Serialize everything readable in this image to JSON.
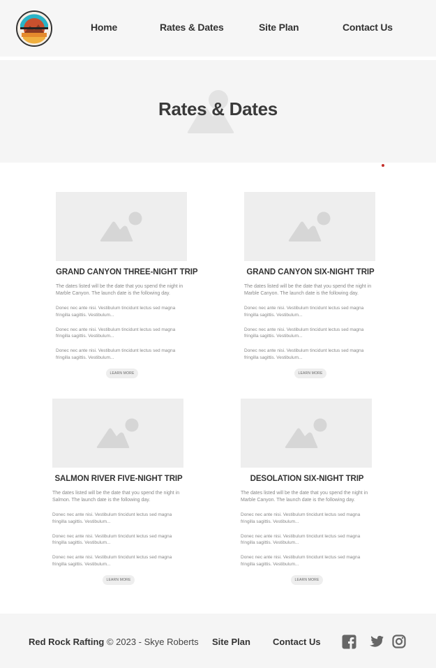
{
  "nav": {
    "logo": "red-rock-rafting-logo",
    "items": [
      "Home",
      "Rates & Dates",
      "Site Plan",
      "Contact Us"
    ]
  },
  "hero": {
    "title": "Rates & Dates"
  },
  "cards": [
    {
      "title": "GRAND CANYON THREE-NIGHT TRIP",
      "intro": "The dates listed will be the date that you spend the night in Marble Canyon. The launch date is the following day.",
      "paras": [
        "Donec nec ante nisi. Vestibulum tincidunt lectus sed magna fringilla sagittis. Vestibulum...",
        "Donec nec ante nisi. Vestibulum tincidunt lectus sed magna fringilla sagittis. Vestibulum...",
        "Donec nec ante nisi. Vestibulum tincidunt lectus sed magna fringilla sagittis. Vestibulum..."
      ],
      "button": "LEARN MORE"
    },
    {
      "title": "GRAND CANYON SIX-NIGHT TRIP",
      "intro": "The dates listed will be the date that you spend the night in Marble Canyon. The launch date is the following day.",
      "paras": [
        "Donec nec ante nisi. Vestibulum tincidunt lectus sed magna fringilla sagittis. Vestibulum...",
        "Donec nec ante nisi. Vestibulum tincidunt lectus sed magna fringilla sagittis. Vestibulum...",
        "Donec nec ante nisi. Vestibulum tincidunt lectus sed magna fringilla sagittis. Vestibulum..."
      ],
      "button": "LEARN MORE"
    },
    {
      "title": "SALMON RIVER FIVE-NIGHT TRIP",
      "intro": "The dates listed will be the date that you spend the night in Salmon. The launch date is the following day.",
      "paras": [
        "Donec nec ante nisi. Vestibulum tincidunt lectus sed magna fringilla sagittis. Vestibulum...",
        "Donec nec ante nisi. Vestibulum tincidunt lectus sed magna fringilla sagittis. Vestibulum...",
        "Donec nec ante nisi. Vestibulum tincidunt lectus sed magna fringilla sagittis. Vestibulum..."
      ],
      "button": "LEARN MORE"
    },
    {
      "title": "DESOLATION SIX-NIGHT TRIP",
      "intro": "The dates listed will be the date that you spend the night in Marble Canyon. The launch date is the following day.",
      "paras": [
        "Donec nec ante nisi. Vestibulum tincidunt lectus sed magna fringilla sagittis. Vestibulum...",
        "Donec nec ante nisi. Vestibulum tincidunt lectus sed magna fringilla sagittis. Vestibulum...",
        "Donec nec ante nisi. Vestibulum tincidunt lectus sed magna fringilla sagittis. Vestibulum..."
      ],
      "button": "LEARN MORE"
    }
  ],
  "footer": {
    "brand": "Red Rock Rafting",
    "copyright": " © 2023 - Skye Roberts",
    "links": [
      "Site Plan",
      "Contact Us"
    ],
    "social": [
      "facebook-icon",
      "twitter-icon",
      "instagram-icon"
    ]
  },
  "colors": {
    "header_bg": "#f6f6f6",
    "placeholder": "#eeeeee",
    "placeholder_icon": "#d6d6d6",
    "accent_red": "#c4302b",
    "text_dark": "#333333",
    "text_muted": "#888888",
    "icon_gray": "#666666"
  }
}
